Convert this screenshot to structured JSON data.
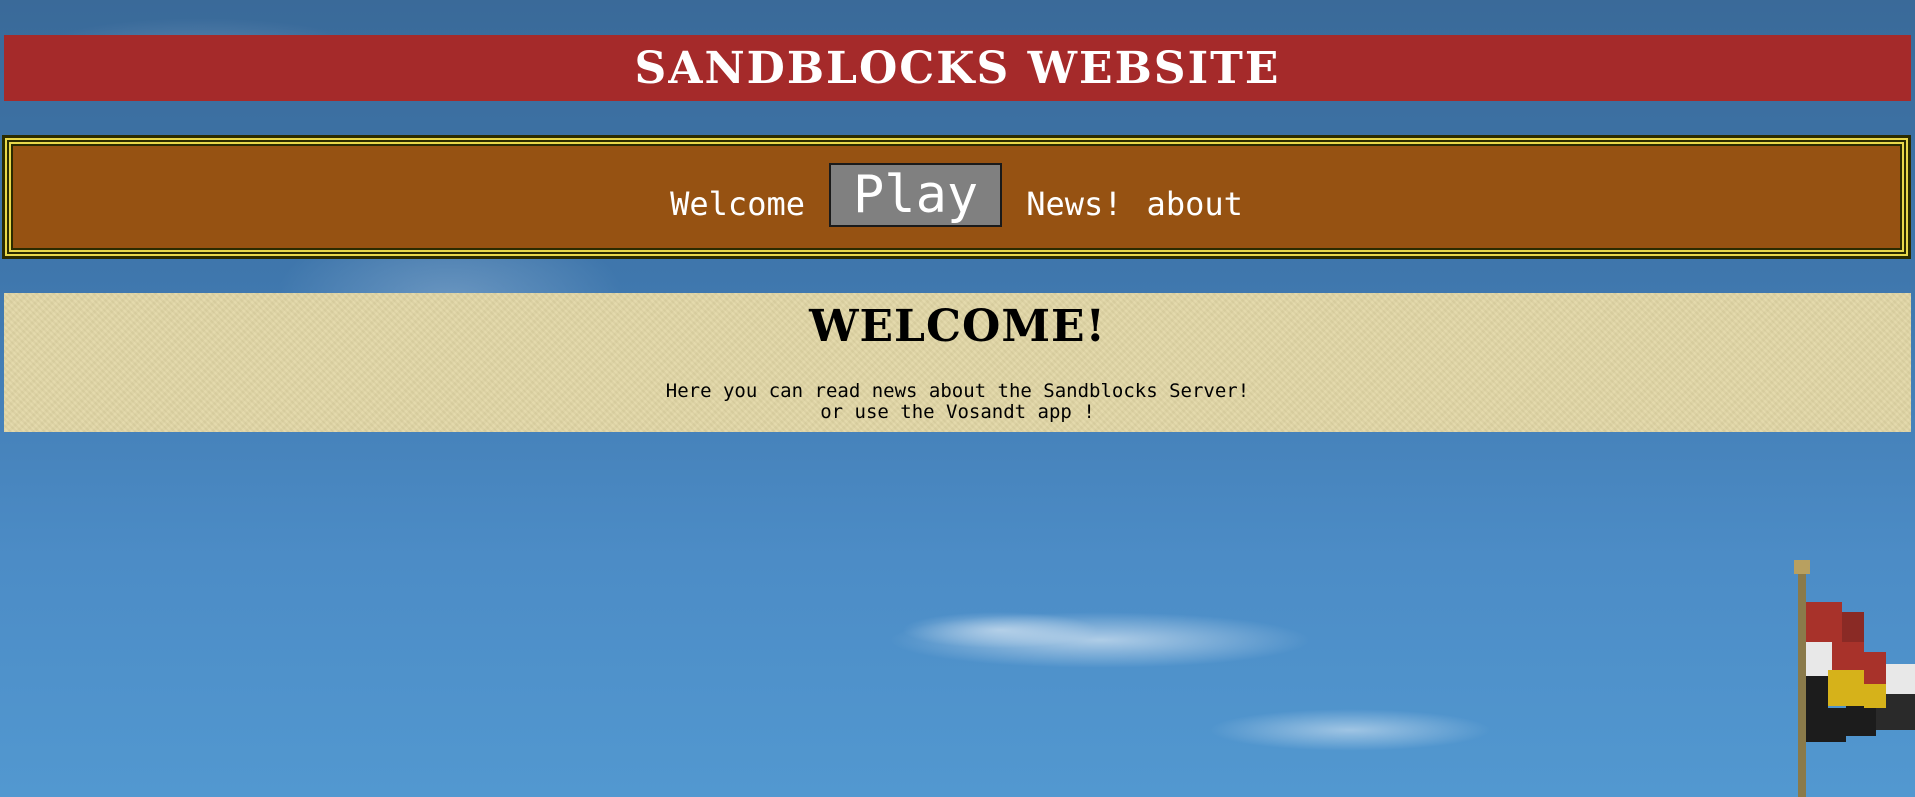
{
  "header": {
    "title": "Sandblocks Website"
  },
  "nav": {
    "items": [
      {
        "label": "Welcome",
        "active": false
      },
      {
        "label": "Play",
        "active": true
      },
      {
        "label": "News!",
        "active": false
      },
      {
        "label": "about",
        "active": false
      }
    ]
  },
  "welcome": {
    "heading": "WELCOME!",
    "line1": "Here you can read news about the Sandblocks Server!",
    "line2": "or use the Vosandt app !"
  },
  "colors": {
    "title_bar": "#a52a2a",
    "nav_bar": "#965212",
    "nav_border": "#e8d84a",
    "active_tab": "#808080",
    "welcome_panel": "#e2d7a6",
    "sky": "#4c8cc6"
  }
}
